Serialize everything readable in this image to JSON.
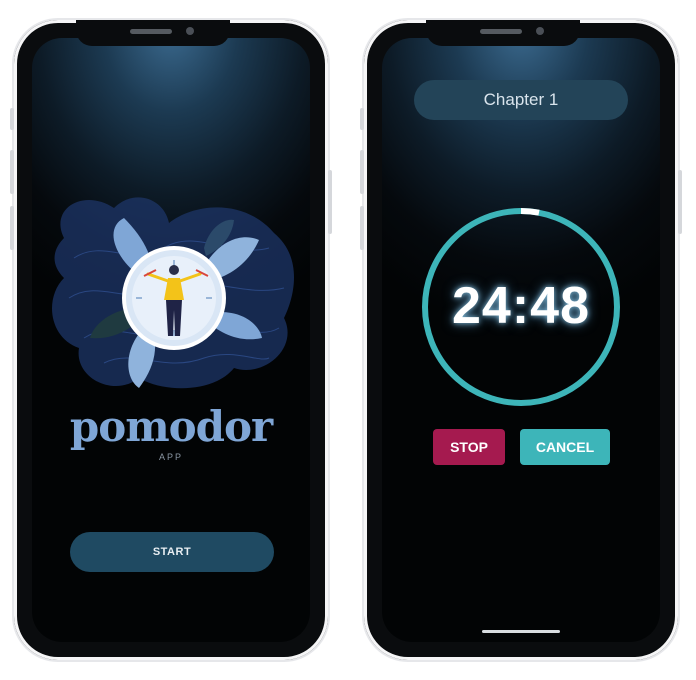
{
  "left_screen": {
    "logo_text": "pomodor",
    "logo_subtitle": "APP",
    "start_label": "START"
  },
  "right_screen": {
    "chapter_title": "Chapter 1",
    "timer": "24:48",
    "timer_progress": 0.03,
    "stop_label": "STOP",
    "cancel_label": "CANCEL"
  },
  "colors": {
    "ring": "#3db5b9",
    "stop": "#a51a4f",
    "cancel": "#3db5b9",
    "start_button": "#1f4a62",
    "logo": "#7fa6d6"
  },
  "icons": {
    "hero": "clock-person-illustration-icon"
  }
}
